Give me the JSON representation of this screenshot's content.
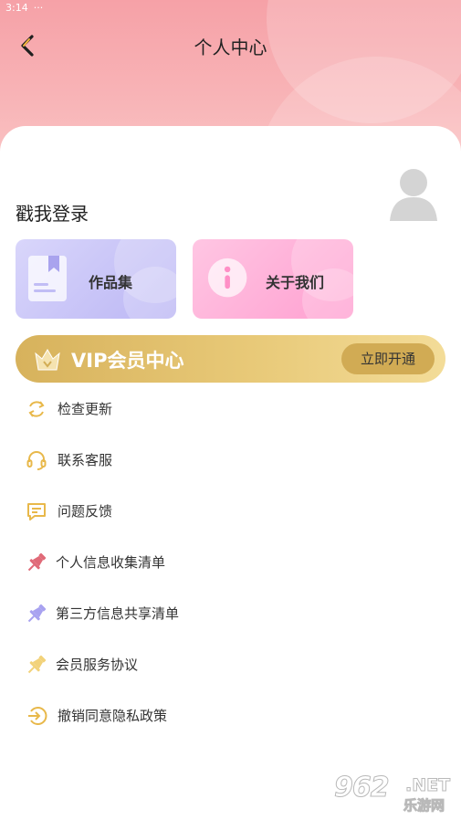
{
  "status_bar": {
    "time": "3:14",
    "dots": "···"
  },
  "nav": {
    "title": "个人中心"
  },
  "profile": {
    "login_text": "戳我登录"
  },
  "tiles": {
    "works": {
      "label": "作品集"
    },
    "about": {
      "label": "关于我们"
    }
  },
  "vip": {
    "title": "VIP会员中心",
    "button_label": "立即开通"
  },
  "menu": {
    "items": [
      {
        "label": "检查更新",
        "icon": "refresh-icon"
      },
      {
        "label": "联系客服",
        "icon": "headset-icon"
      },
      {
        "label": "问题反馈",
        "icon": "chat-icon"
      },
      {
        "label": "个人信息收集清单",
        "icon": "pin-icon"
      },
      {
        "label": "第三方信息共享清单",
        "icon": "pin-icon"
      },
      {
        "label": "会员服务协议",
        "icon": "pin-icon"
      },
      {
        "label": "撤销同意隐私政策",
        "icon": "exit-icon"
      }
    ]
  },
  "watermark": {
    "number": "962",
    "domain": ".NET",
    "brand": "乐游网"
  },
  "colors": {
    "header_pink": "#f6a1a7",
    "accent_gold": "#e8b84a",
    "vip_gold": "#d7b25c",
    "pin_red": "#e06a78",
    "pin_purple": "#a8a2f0",
    "pin_yellow": "#f2d27a"
  }
}
